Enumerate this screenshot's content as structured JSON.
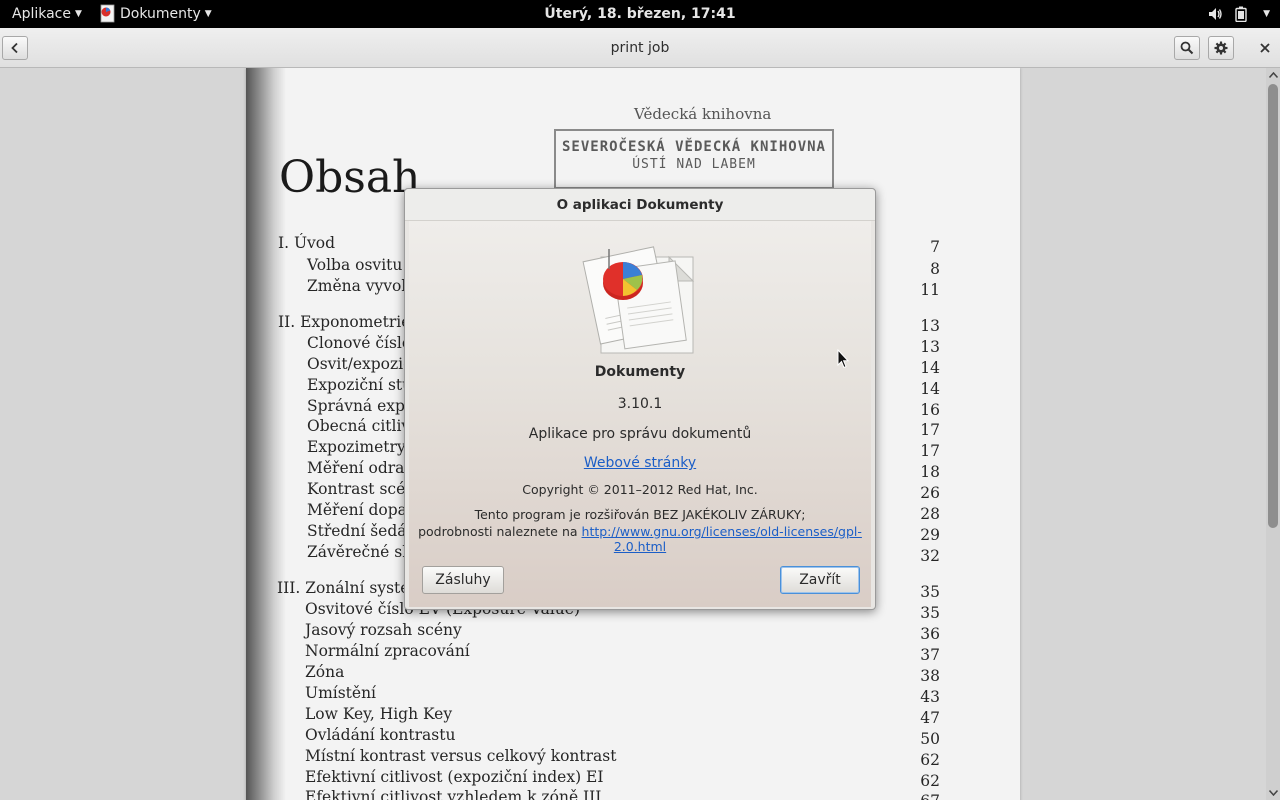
{
  "topbar": {
    "apps_label": "Aplikace",
    "app_menu_label": "Dokumenty",
    "clock": "Úterý, 18. březen, 17:41"
  },
  "header": {
    "title": "print job"
  },
  "document": {
    "heading": "Obsah",
    "stamp_title": "Vědecká knihovna",
    "stamp_line1": "SEVEROČESKÁ VĚDECKÁ KNIHOVNA",
    "stamp_line2": "ÚSTÍ NAD LABEM",
    "toc": [
      {
        "text": "I. Úvod",
        "page": "7"
      },
      {
        "text": "Volba osvitu",
        "page": "8"
      },
      {
        "text": "Změna vyvola",
        "page": "11"
      },
      {
        "text": "II. Exponometrie",
        "page": "13"
      },
      {
        "text": "Clonové číslo",
        "page": "13"
      },
      {
        "text": "Osvit/expozic",
        "page": "14"
      },
      {
        "text": "Expoziční stu",
        "page": "14"
      },
      {
        "text": "Správná expoz",
        "page": "16"
      },
      {
        "text": "Obecná citlive",
        "page": "17"
      },
      {
        "text": "Expozimetry",
        "page": "17"
      },
      {
        "text": "Měření odraž",
        "page": "18"
      },
      {
        "text": "Kontrast scén",
        "page": "26"
      },
      {
        "text": "Měření dopad",
        "page": "28"
      },
      {
        "text": "Střední šedá",
        "page": "29"
      },
      {
        "text": "Závěrečné shr",
        "page": "32"
      },
      {
        "text": "III. Zonální systém",
        "page": "35"
      },
      {
        "text": "Osvitové číslo EV (Exposure Value)",
        "page": "35"
      },
      {
        "text": "Jasový rozsah scény",
        "page": "36"
      },
      {
        "text": "Normální zpracování",
        "page": "37"
      },
      {
        "text": "Zóna",
        "page": "38"
      },
      {
        "text": "Umístění",
        "page": "43"
      },
      {
        "text": "Low Key, High Key",
        "page": "47"
      },
      {
        "text": "Ovládání kontrastu",
        "page": "50"
      },
      {
        "text": "Místní kontrast versus celkový kontrast",
        "page": "62"
      },
      {
        "text": "Efektivní citlivost (expoziční index) EI",
        "page": "62"
      },
      {
        "text": "Efektivní citlivost vzhledem k zóně III",
        "page": "67"
      }
    ]
  },
  "dialog": {
    "title": "O aplikaci Dokumenty",
    "program_name": "Dokumenty",
    "version": "3.10.1",
    "comment": "Aplikace pro správu dokumentů",
    "website_label": "Webové stránky",
    "copyright": "Copyright © 2011–2012 Red Hat, Inc.",
    "license_line1": "Tento program je rozšiřován BEZ JAKÉKOLIV ZÁRUKY;",
    "license_line2_prefix": "podrobnosti naleznete na ",
    "license_url": "http://www.gnu.org/licenses/old-licenses/gpl-2.0.html",
    "credits_button": "Zásluhy",
    "close_button": "Zavřít"
  },
  "icons": {
    "back": "go-previous-icon",
    "search": "search-icon",
    "settings": "gear-icon",
    "close": "close-icon",
    "volume": "volume-icon",
    "battery": "battery-icon"
  }
}
